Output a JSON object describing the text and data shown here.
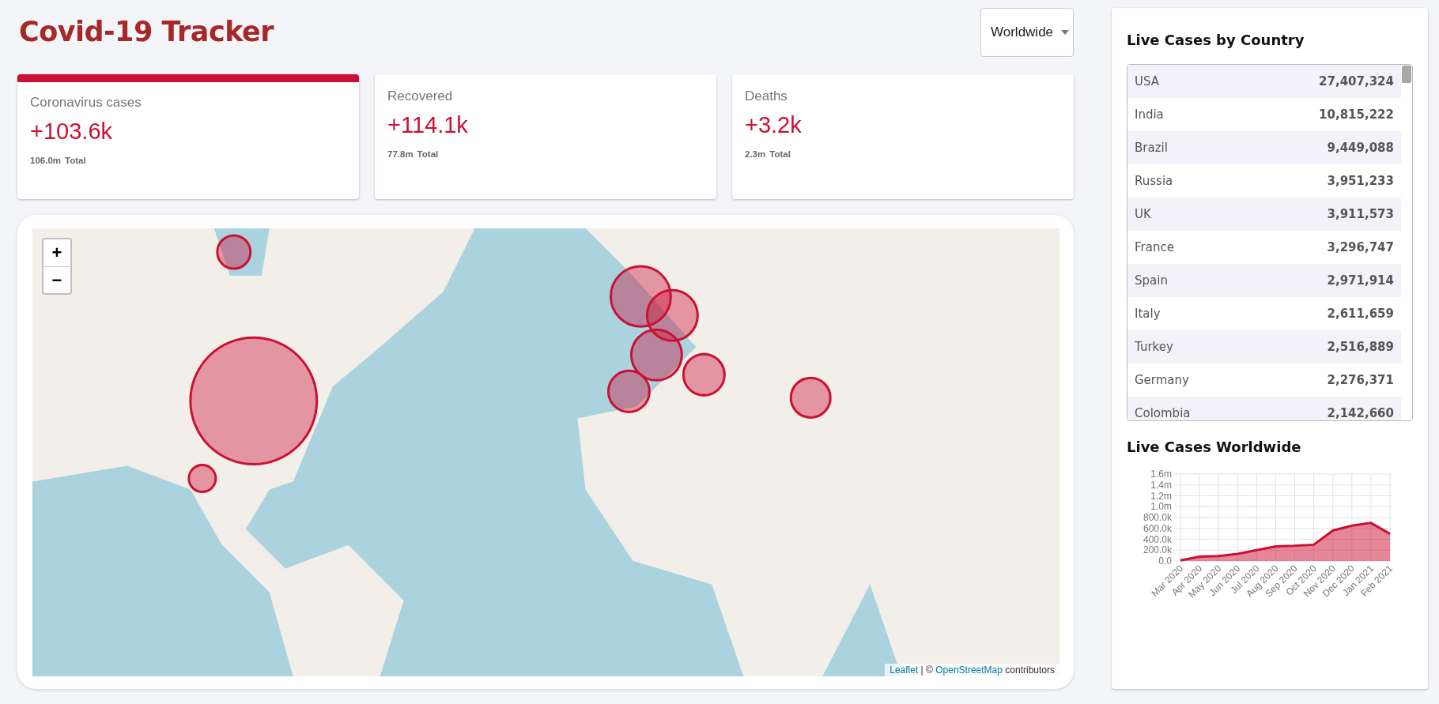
{
  "header": {
    "title": "Covid-19 Tracker",
    "region_select": {
      "value": "Worldwide"
    }
  },
  "stats": [
    {
      "label": "Coronavirus cases",
      "today": "+103.6k",
      "total": "106.0m",
      "total_label": "Total",
      "selected": true
    },
    {
      "label": "Recovered",
      "today": "+114.1k",
      "total": "77.8m",
      "total_label": "Total",
      "selected": false
    },
    {
      "label": "Deaths",
      "today": "+3.2k",
      "total": "2.3m",
      "total_label": "Total",
      "selected": false
    }
  ],
  "map": {
    "kind": "picture",
    "zoom_in": "+",
    "zoom_out": "−",
    "attribution": {
      "links": [
        "Leaflet",
        "OpenStreetMap"
      ],
      "separator": "| ©",
      "suffix": "contributors"
    }
  },
  "sidebar": {
    "table_title": "Live Cases by Country",
    "table": {
      "rows": [
        {
          "country": "USA",
          "cases": "27,407,324"
        },
        {
          "country": "India",
          "cases": "10,815,222"
        },
        {
          "country": "Brazil",
          "cases": "9,449,088"
        },
        {
          "country": "Russia",
          "cases": "3,951,233"
        },
        {
          "country": "UK",
          "cases": "3,911,573"
        },
        {
          "country": "France",
          "cases": "3,296,747"
        },
        {
          "country": "Spain",
          "cases": "2,971,914"
        },
        {
          "country": "Italy",
          "cases": "2,611,659"
        },
        {
          "country": "Turkey",
          "cases": "2,516,889"
        },
        {
          "country": "Germany",
          "cases": "2,276,371"
        },
        {
          "country": "Colombia",
          "cases": "2,142,660"
        }
      ]
    },
    "chart_title": "Live Cases Worldwide",
    "chart_data": {
      "type": "area",
      "categories": [
        "Mar 2020",
        "Apr 2020",
        "May 2020",
        "Jun 2020",
        "Jul 2020",
        "Aug 2020",
        "Sep 2020",
        "Oct 2020",
        "Nov 2020",
        "Dec 2020",
        "Jan 2021",
        "Feb 2021"
      ],
      "values": [
        10000,
        80000,
        90000,
        130000,
        200000,
        270000,
        280000,
        300000,
        560000,
        650000,
        700000,
        500000
      ],
      "grid": true,
      "ylim": [
        0,
        1600000
      ],
      "yticks": [
        {
          "value": 0,
          "label": "0.0"
        },
        {
          "value": 200000,
          "label": "200.0k"
        },
        {
          "value": 400000,
          "label": "400.0k"
        },
        {
          "value": 600000,
          "label": "600.0k"
        },
        {
          "value": 800000,
          "label": "800.0k"
        },
        {
          "value": 1000000,
          "label": "1.0m"
        },
        {
          "value": 1200000,
          "label": "1.2m"
        },
        {
          "value": 1400000,
          "label": "1.4m"
        },
        {
          "value": 1600000,
          "label": "1.6m"
        }
      ]
    }
  }
}
